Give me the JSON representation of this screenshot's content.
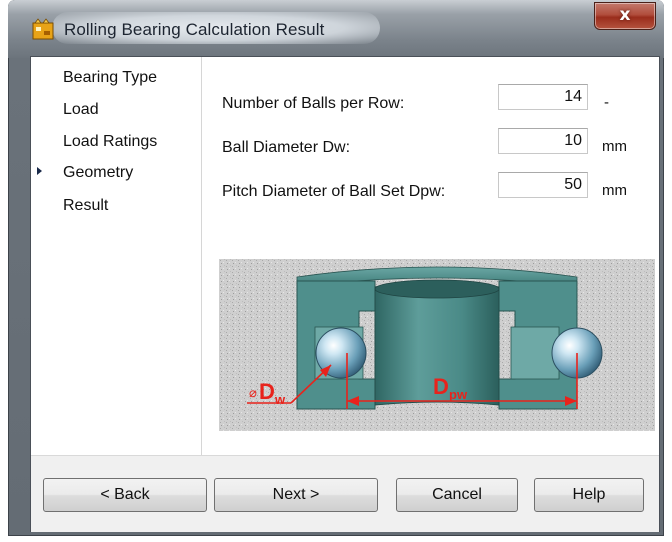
{
  "window": {
    "title": "Rolling Bearing Calculation Result",
    "close_label": "x",
    "icon": "app-logo-icon"
  },
  "nav": {
    "items": [
      {
        "label": "Bearing Type",
        "selected": false
      },
      {
        "label": "Load",
        "selected": false
      },
      {
        "label": "Load Ratings",
        "selected": false
      },
      {
        "label": "Geometry",
        "selected": true
      },
      {
        "label": "Result",
        "selected": false
      }
    ]
  },
  "geometry": {
    "fields": [
      {
        "label": "Number of Balls per Row:",
        "value": "14",
        "unit": "-"
      },
      {
        "label": "Ball Diameter Dw:",
        "value": "10",
        "unit": "mm"
      },
      {
        "label": "Pitch Diameter of Ball Set Dpw:",
        "value": "50",
        "unit": "mm"
      }
    ],
    "diagram": {
      "dw_prefix": "⌀",
      "dw_main": "D",
      "dw_sub": "w",
      "dpw_main": "D",
      "dpw_sub": "pw",
      "dimension_color": "#e8231c",
      "bearing_color": "#4f8f8c"
    }
  },
  "buttons": {
    "back": "< Back",
    "next": "Next >",
    "cancel": "Cancel",
    "help": "Help"
  }
}
